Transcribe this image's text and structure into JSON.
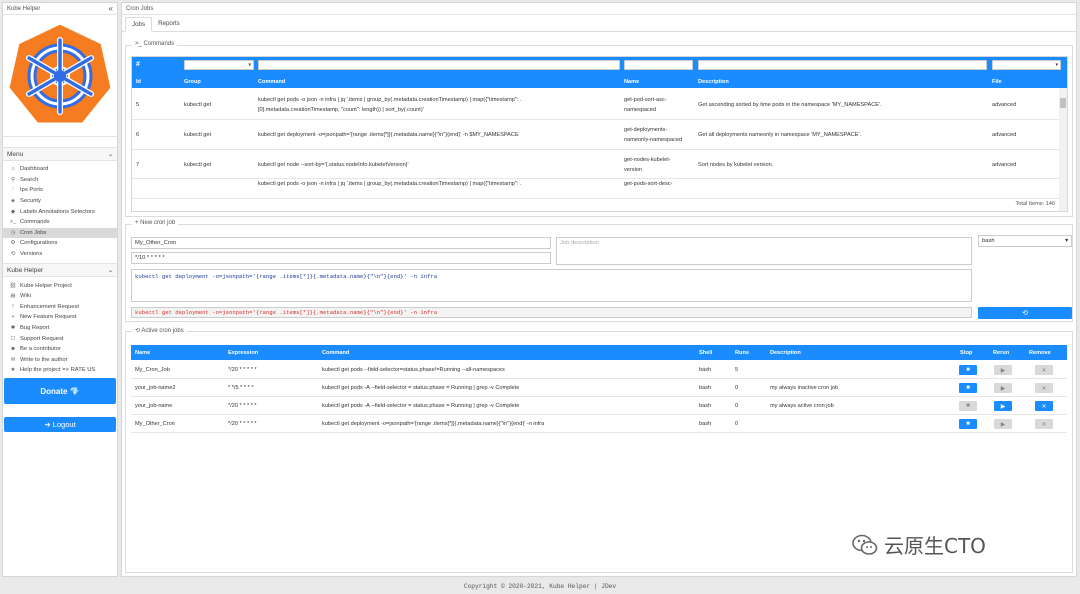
{
  "sidebar": {
    "title": "Kube Helper",
    "collapse_icon": "«",
    "menu_title": "Menu",
    "menu_items": [
      {
        "icon": "home-icon",
        "glyph": "⌂",
        "label": "Dashboard"
      },
      {
        "icon": "search-icon",
        "glyph": "⚲",
        "label": "Search"
      },
      {
        "icon": "plug-icon",
        "glyph": "⋮",
        "label": "Ips Ports"
      },
      {
        "icon": "shield-icon",
        "glyph": "◈",
        "label": "Security"
      },
      {
        "icon": "tag-icon",
        "glyph": "◆",
        "label": "Labels Annotations Selectors"
      },
      {
        "icon": "terminal-icon",
        "glyph": ">_",
        "label": "Commands"
      },
      {
        "icon": "clock-icon",
        "glyph": "◷",
        "label": "Cron Jobs"
      },
      {
        "icon": "gear-icon",
        "glyph": "⚙",
        "label": "Configurations"
      },
      {
        "icon": "history-icon",
        "glyph": "⟲",
        "label": "Versions"
      }
    ],
    "helper_title": "Kube Helper",
    "helper_items": [
      {
        "icon": "link-icon",
        "glyph": "⛓",
        "label": "Kube Helper Project"
      },
      {
        "icon": "book-icon",
        "glyph": "▤",
        "label": "Wiki"
      },
      {
        "icon": "exclamation-icon",
        "glyph": "!",
        "label": "Enhancement Request"
      },
      {
        "icon": "plus-icon",
        "glyph": "+",
        "label": "New Feature Request"
      },
      {
        "icon": "bug-icon",
        "glyph": "✱",
        "label": "Bug Report"
      },
      {
        "icon": "support-icon",
        "glyph": "☐",
        "label": "Support Request"
      },
      {
        "icon": "user-icon",
        "glyph": "☻",
        "label": "Be a contributor"
      },
      {
        "icon": "mail-icon",
        "glyph": "✉",
        "label": "Write to the author"
      },
      {
        "icon": "star-icon",
        "glyph": "★",
        "label": "Help the project => RATE US"
      }
    ],
    "donate_label": "Donate 💎",
    "logout_label": "➜ Logout"
  },
  "main": {
    "title": "Cron Jobs",
    "tabs": [
      "Jobs",
      "Reports"
    ]
  },
  "commands": {
    "legend": ">_ Commands",
    "hash": "#",
    "columns": [
      "Id",
      "Group",
      "Command",
      "Name",
      "Description",
      "File"
    ],
    "rows": [
      {
        "id": "5",
        "group": "kubectl get",
        "command": [
          "kubectl get pods -o json -n infra | jq '.items | group_by(.metadata.creationTimestamp) | map({\"timestamp\": .",
          "[0].metadata.creationTimestamp, \"count\": length}) | sort_by(.count)'"
        ],
        "name": [
          "get-pod-sort-asc-",
          "namespaced"
        ],
        "description": "Get ascending sorted by time pods in the namespace 'MY_NAMESPACE'.",
        "file": "advanced"
      },
      {
        "id": "6",
        "group": "kubectl get",
        "command": [
          "kubectl get deployment -o=jsonpath='{range .items[*]}{.metadata.name}{\"\\n\"}{end}' -n $MY_NAMESPACE"
        ],
        "name": [
          "get-deployments-",
          "nameonly-namespaced"
        ],
        "description": "Get all deployments nameonly in namespace 'MY_NAMESPACE'.",
        "file": "advanced"
      },
      {
        "id": "7",
        "group": "kubectl get",
        "command": [
          "kubectl get node --sort-by='{.status.nodeInfo.kubeletVersion}'"
        ],
        "name": [
          "get-nodes-kubelet-",
          "version"
        ],
        "description": "Sort nodes by kubelet version.",
        "file": "advanced"
      },
      {
        "id": "",
        "group": "",
        "command": [
          "kubectl get pods -o json -n infra | jq '.items | group_by(.metadata.creationTimestamp) | map({\"timestamp\": ."
        ],
        "name": [
          "get-pods-sort-desc-"
        ],
        "description": "",
        "file": ""
      }
    ],
    "total": "Total Items: 146"
  },
  "new_job": {
    "legend": "+ New cron job",
    "name_value": "My_Other_Cron",
    "expression_value": "*/10 * * * * *",
    "description_placeholder": "Job description",
    "shell_value": "bash",
    "command_value": "kubectl get deployment -o=jsonpath='{range .items[*]}{.metadata.name}{\"\\n\"}{end}' -n infra",
    "preview": "kubectl get deployment -o=jsonpath='{range .items[*]}{.metadata.name}{\"\\n\"}{end}' -n infra",
    "refresh_icon": "⟲"
  },
  "active": {
    "legend": "⟲ Active cron jobs",
    "columns": [
      "Name",
      "Expression",
      "Command",
      "Shell",
      "Runs",
      "Description",
      "Stop",
      "Rerun",
      "Remove"
    ],
    "rows": [
      {
        "name": "My_Cron_Job",
        "expression": "*/20 * * * * *",
        "command": "kubectl get pods --field-selector=status.phase!=Running --all-namespaces",
        "shell": "bash",
        "runs": "5",
        "description": "",
        "stop": "active",
        "rerun": "disabled",
        "remove": "disabled"
      },
      {
        "name": "your_job-name2",
        "expression": "* */5 * * * *",
        "command": "kubectl get pods -A --field-selector = status.phase = Running | grep -v Complete",
        "shell": "bash",
        "runs": "0",
        "description": "my always inactive cron job",
        "stop": "active",
        "rerun": "disabled",
        "remove": "disabled"
      },
      {
        "name": "your_job-name",
        "expression": "*/20 * * * * *",
        "command": "kubectl get pods -A --field-selector = status.phase = Running | grep -v Complete",
        "shell": "bash",
        "runs": "0",
        "description": "my always active cron job",
        "stop": "disabled",
        "rerun": "active",
        "remove": "active"
      },
      {
        "name": "My_Other_Cron",
        "expression": "*/20 * * * * *",
        "command": "kubectl get deployment -o=jsonpath='{range .items[*]}{.metadata.name}{\"\\n\"}{end}' -n infra",
        "shell": "bash",
        "runs": "0",
        "description": "",
        "stop": "active",
        "rerun": "disabled",
        "remove": "disabled"
      }
    ]
  },
  "footer": "Copyright © 2020-2021, Kube Helper   |   JDev",
  "watermark": "云原生CTO",
  "colors": {
    "accent": "#1a8cff",
    "logo_orange": "#f57c20",
    "logo_blue": "#326ce5"
  }
}
